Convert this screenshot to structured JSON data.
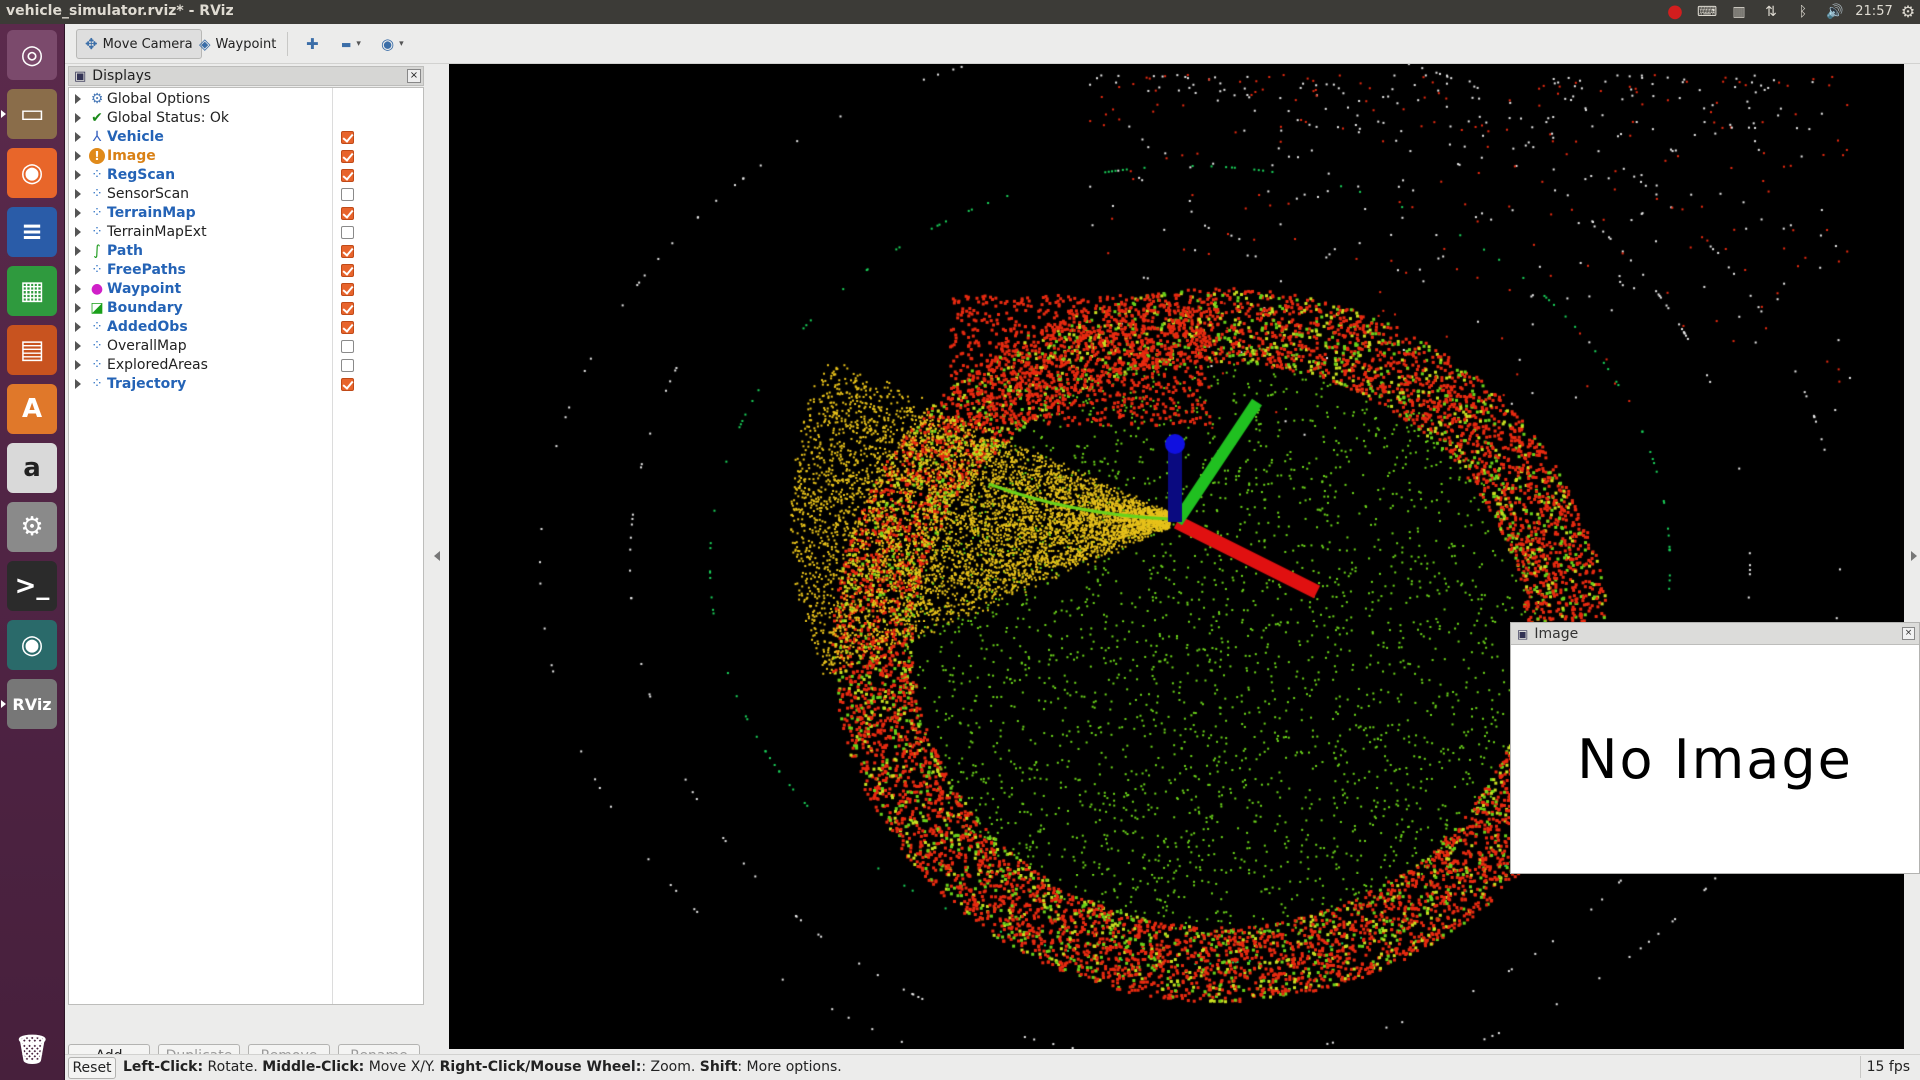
{
  "window": {
    "title": "vehicle_simulator.rviz* - RViz"
  },
  "topbar": {
    "indicators": [
      {
        "name": "record-icon",
        "glyph": "●",
        "color": "#d21e1e"
      },
      {
        "name": "keyboard-icon",
        "glyph": "⌨",
        "color": "#dfdbd2"
      },
      {
        "name": "input-method-icon",
        "glyph": "▥",
        "color": "#dfdbd2"
      },
      {
        "name": "network-icon",
        "glyph": "⇅",
        "color": "#dfdbd2"
      },
      {
        "name": "bluetooth-icon",
        "glyph": "ᛒ",
        "color": "#dfdbd2"
      },
      {
        "name": "volume-icon",
        "glyph": "🔊",
        "color": "#dfdbd2"
      }
    ],
    "clock": "21:57",
    "settings_glyph": "⚙"
  },
  "launcher": {
    "items": [
      {
        "name": "ubuntu-dash-icon",
        "glyph": "◎",
        "bg": "#7b4a6c"
      },
      {
        "name": "files-icon",
        "glyph": "▭",
        "bg": "#8a6d4a"
      },
      {
        "name": "firefox-icon",
        "glyph": "◉",
        "bg": "#e8662a"
      },
      {
        "name": "writer-icon",
        "glyph": "≡",
        "bg": "#2a5ca8"
      },
      {
        "name": "calc-icon",
        "glyph": "▦",
        "bg": "#2f9a3e"
      },
      {
        "name": "impress-icon",
        "glyph": "▤",
        "bg": "#c8531f"
      },
      {
        "name": "software-center-icon",
        "glyph": "A",
        "bg": "#e0782a"
      },
      {
        "name": "amazon-icon",
        "glyph": "a",
        "bg": "#d9d9d9"
      },
      {
        "name": "system-settings-icon",
        "glyph": "⚙",
        "bg": "#8a8a8a"
      },
      {
        "name": "terminal-icon",
        "glyph": ">_",
        "bg": "#2b2b2b"
      },
      {
        "name": "camera-icon",
        "glyph": "◉",
        "bg": "#2a6a6a"
      },
      {
        "name": "rviz-icon",
        "glyph": "RViz",
        "bg": "#777777"
      }
    ],
    "trash_glyph": "🗑"
  },
  "toolbar": {
    "move_camera_label": "Move Camera",
    "waypoint_label": "Waypoint",
    "move_camera_glyph": "✥",
    "waypoint_glyph": "◈",
    "add_glyph": "✚",
    "remove_glyph": "▬",
    "view_glyph": "◉"
  },
  "displays": {
    "header": "Displays",
    "close_glyph": "×",
    "items": [
      {
        "label": "Global Options",
        "style": "plain",
        "icon": "gear-icon",
        "glyph": "⚙",
        "icon_color": "#4a7ab8",
        "checkbox": "none"
      },
      {
        "label": "Global Status: Ok",
        "style": "plain",
        "icon": "check-icon",
        "glyph": "✔",
        "icon_color": "#1a8a1a",
        "checkbox": "none"
      },
      {
        "label": "Vehicle",
        "style": "en",
        "icon": "axes-icon",
        "glyph": "⅄",
        "icon_color": "#3560c0",
        "checkbox": "on"
      },
      {
        "label": "Image",
        "style": "warn",
        "icon": "warning-icon",
        "glyph": "!",
        "icon_color": "#e08a1a",
        "checkbox": "on"
      },
      {
        "label": "RegScan",
        "style": "en",
        "icon": "pointcloud-icon",
        "glyph": "⁘",
        "icon_color": "#3a7ac8",
        "checkbox": "on"
      },
      {
        "label": "SensorScan",
        "style": "plain",
        "icon": "pointcloud-icon",
        "glyph": "⁘",
        "icon_color": "#3a7ac8",
        "checkbox": "off"
      },
      {
        "label": "TerrainMap",
        "style": "en",
        "icon": "pointcloud-icon",
        "glyph": "⁘",
        "icon_color": "#3a7ac8",
        "checkbox": "on"
      },
      {
        "label": "TerrainMapExt",
        "style": "plain",
        "icon": "pointcloud-icon",
        "glyph": "⁘",
        "icon_color": "#3a7ac8",
        "checkbox": "off"
      },
      {
        "label": "Path",
        "style": "en",
        "icon": "path-icon",
        "glyph": "∫",
        "icon_color": "#1a9a1a",
        "checkbox": "on"
      },
      {
        "label": "FreePaths",
        "style": "en",
        "icon": "pointcloud-icon",
        "glyph": "⁘",
        "icon_color": "#3a7ac8",
        "checkbox": "on"
      },
      {
        "label": "Waypoint",
        "style": "en",
        "icon": "point-icon",
        "glyph": "●",
        "icon_color": "#d020c8",
        "checkbox": "on"
      },
      {
        "label": "Boundary",
        "style": "en",
        "icon": "polygon-icon",
        "glyph": "◪",
        "icon_color": "#1aa01a",
        "checkbox": "on"
      },
      {
        "label": "AddedObs",
        "style": "en",
        "icon": "pointcloud-icon",
        "glyph": "⁘",
        "icon_color": "#3a7ac8",
        "checkbox": "on"
      },
      {
        "label": "OverallMap",
        "style": "plain",
        "icon": "pointcloud-icon",
        "glyph": "⁘",
        "icon_color": "#3a7ac8",
        "checkbox": "off"
      },
      {
        "label": "ExploredAreas",
        "style": "plain",
        "icon": "pointcloud-icon",
        "glyph": "⁘",
        "icon_color": "#3a7ac8",
        "checkbox": "off"
      },
      {
        "label": "Trajectory",
        "style": "en",
        "icon": "pointcloud-icon",
        "glyph": "⁘",
        "icon_color": "#3a7ac8",
        "checkbox": "on"
      }
    ],
    "buttons": {
      "add": "Add",
      "duplicate": "Duplicate",
      "remove": "Remove",
      "rename": "Rename"
    }
  },
  "image_panel": {
    "title": "Image",
    "message": "No Image",
    "close_glyph": "×"
  },
  "status": {
    "reset": "Reset",
    "hint_parts": [
      {
        "text": "Left-Click:",
        "bold": true
      },
      {
        "text": " Rotate. ",
        "bold": false
      },
      {
        "text": "Middle-Click:",
        "bold": true
      },
      {
        "text": " Move X/Y. ",
        "bold": false
      },
      {
        "text": "Right-Click/Mouse Wheel:",
        "bold": true
      },
      {
        "text": ": Zoom. ",
        "bold": false
      },
      {
        "text": "Shift",
        "bold": true
      },
      {
        "text": ": More options.",
        "bold": false
      }
    ],
    "fps": "15 fps"
  },
  "colors": {
    "ground_hit": "#e82a10",
    "free_ground": "#6ad21a",
    "free_paths": "#e8c21a",
    "trajectory": "#1ad25a",
    "background_map": "#e8e8e8",
    "axis_x": "#e01010",
    "axis_y": "#20c020",
    "axis_z": "#1010e0"
  }
}
